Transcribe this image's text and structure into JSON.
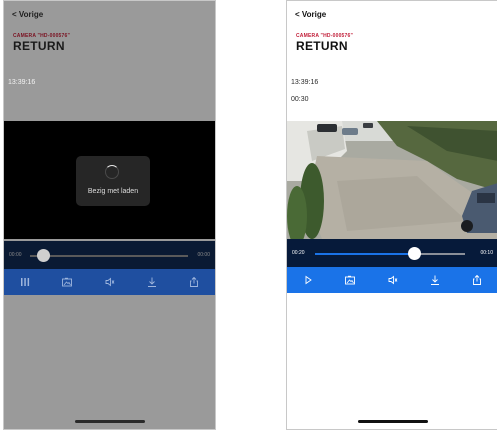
{
  "left": {
    "back_label": "< Vorige",
    "camera_label": "CAMERA \"HD-000576\"",
    "title": "RETURN",
    "time": "13:39:16",
    "loading_text": "Bezig met laden",
    "scrub_start": "00:00",
    "scrub_end": "00:00",
    "progress": 0.0
  },
  "right": {
    "back_label": "< Vorige",
    "camera_label": "CAMERA \"HD-000576\"",
    "title": "RETURN",
    "time": "13:39:16",
    "duration": "00:30",
    "scrub_start": "00:20",
    "scrub_end": "00:10",
    "progress": 0.66
  },
  "colors": {
    "accent_blue": "#1a73e8",
    "camera_red": "#c11d38",
    "video_bar_dark": "#061a3a"
  },
  "icons": {
    "toolbar_left": [
      "pause-icon",
      "snapshot-icon",
      "mute-icon",
      "download-icon",
      "share-icon"
    ],
    "toolbar_right": [
      "play-icon",
      "snapshot-icon",
      "mute-icon",
      "download-icon",
      "share-icon"
    ]
  }
}
